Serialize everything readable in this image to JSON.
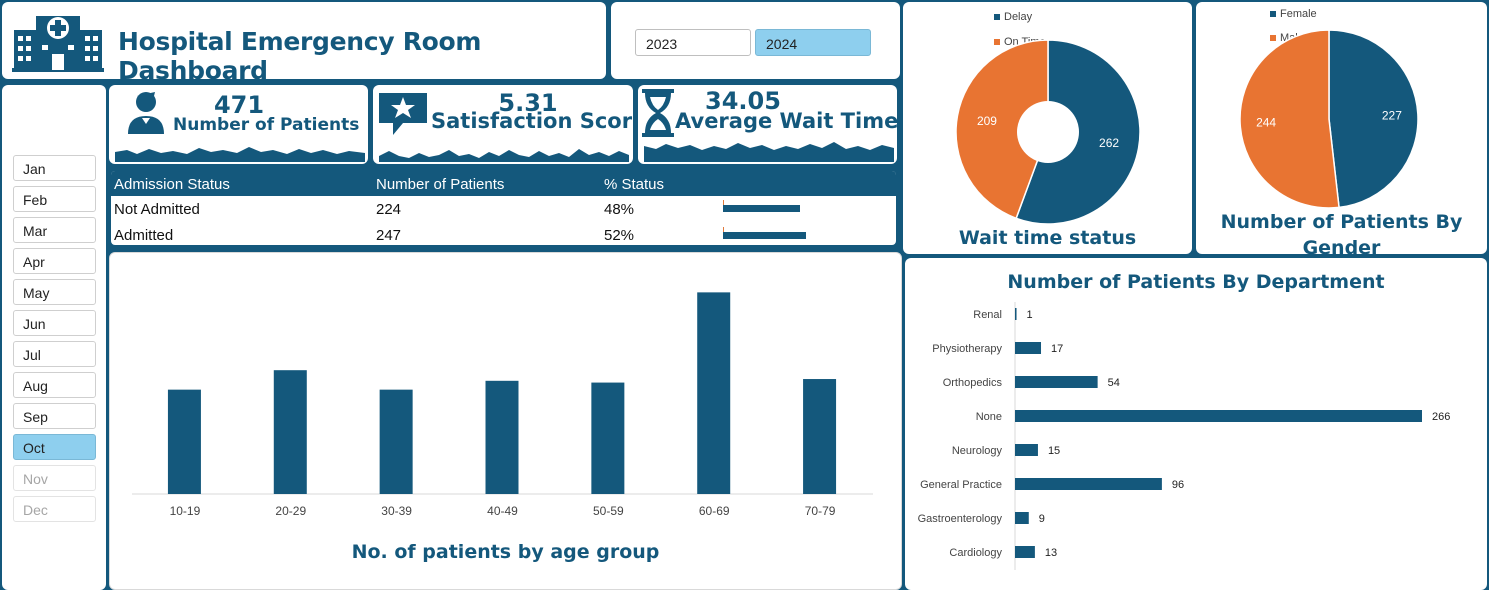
{
  "header": {
    "title": "Hospital Emergency Room Dashboard",
    "logo_icon": "hospital-icon"
  },
  "year_slicer": {
    "options": [
      {
        "label": "2023",
        "selected": false
      },
      {
        "label": "2024",
        "selected": true
      }
    ]
  },
  "month_slicer": {
    "items": [
      {
        "label": "Jan",
        "state": "normal"
      },
      {
        "label": "Feb",
        "state": "normal"
      },
      {
        "label": "Mar",
        "state": "normal"
      },
      {
        "label": "Apr",
        "state": "normal"
      },
      {
        "label": "May",
        "state": "normal"
      },
      {
        "label": "Jun",
        "state": "normal"
      },
      {
        "label": "Jul",
        "state": "normal"
      },
      {
        "label": "Aug",
        "state": "normal"
      },
      {
        "label": "Sep",
        "state": "normal"
      },
      {
        "label": "Oct",
        "state": "selected"
      },
      {
        "label": "Nov",
        "state": "disabled"
      },
      {
        "label": "Dec",
        "state": "disabled"
      }
    ]
  },
  "kpis": {
    "patients": {
      "value": "471",
      "label": "Number of Patients",
      "icon": "patient-icon"
    },
    "satisfaction": {
      "value": "5.31",
      "label": "Satisfaction Score",
      "icon": "star-speech-bubble-icon"
    },
    "wait": {
      "value": "34.05",
      "label": "Average Wait Time",
      "icon": "hourglass-icon"
    }
  },
  "admission_table": {
    "headers": [
      "Admission Status",
      "Number of Patients",
      "% Status"
    ],
    "rows": [
      {
        "status": "Not Admitted",
        "count": "224",
        "pct": "48%",
        "fraction": 0.48
      },
      {
        "status": "Admitted",
        "count": "247",
        "pct": "52%",
        "fraction": 0.52
      }
    ]
  },
  "colors": {
    "primary": "#14587c",
    "secondary": "#e87432",
    "selected": "#8ecfee"
  },
  "chart_data": [
    {
      "type": "bar",
      "title": "No. of patients by age group",
      "categories": [
        "10-19",
        "20-29",
        "30-39",
        "40-49",
        "50-59",
        "60-69",
        "70-79"
      ],
      "values": [
        59,
        70,
        59,
        64,
        63,
        114,
        65
      ],
      "ylim": [
        0,
        120
      ],
      "grid": false
    },
    {
      "type": "pie",
      "title": "Wait time status",
      "series": [
        {
          "name": "Delay",
          "value": 262,
          "color": "#14587c"
        },
        {
          "name": "On Time",
          "value": 209,
          "color": "#e87432"
        }
      ],
      "legend": "top"
    },
    {
      "type": "pie",
      "title": "Number of Patients By Gender",
      "series": [
        {
          "name": "Female",
          "value": 227,
          "color": "#14587c"
        },
        {
          "name": "Male",
          "value": 244,
          "color": "#e87432"
        }
      ],
      "legend": "top-left"
    },
    {
      "type": "bar",
      "orientation": "horizontal",
      "title": "Number of Patients By Department",
      "categories": [
        "Renal",
        "Physiotherapy",
        "Orthopedics",
        "None",
        "Neurology",
        "General Practice",
        "Gastroenterology",
        "Cardiology"
      ],
      "values": [
        1,
        17,
        54,
        266,
        15,
        96,
        9,
        13
      ],
      "grid": false
    }
  ]
}
